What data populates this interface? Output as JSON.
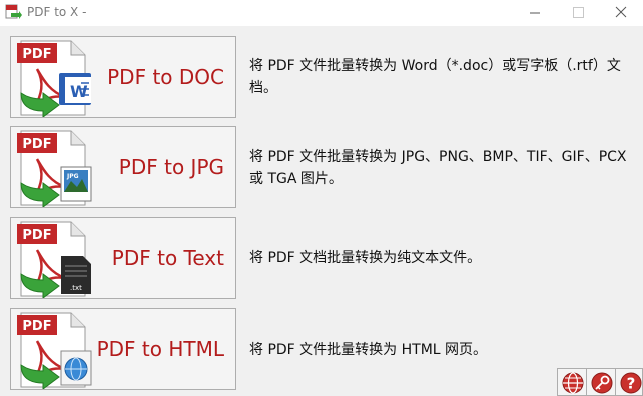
{
  "window": {
    "title": "PDF to X -",
    "minimize_symbol": "—",
    "maximize_symbol": "☐",
    "close_symbol": "✕"
  },
  "tools": [
    {
      "label": "PDF to DOC",
      "badge": "PDF",
      "sub_icon": "word-document-icon",
      "description": "将 PDF 文件批量转换为 Word（*.doc）或写字板（.rtf）文档。"
    },
    {
      "label": "PDF to JPG",
      "badge": "PDF",
      "sub_icon": "jpg-image-icon",
      "sub_text": "JPG",
      "description": "将 PDF 文件批量转换为 JPG、PNG、BMP、TIF、GIF、PCX 或 TGA 图片。"
    },
    {
      "label": "PDF to Text",
      "badge": "PDF",
      "sub_icon": "txt-file-icon",
      "sub_text": ".txt",
      "description": "将 PDF 文档批量转换为纯文本文件。"
    },
    {
      "label": "PDF to HTML",
      "badge": "PDF",
      "sub_icon": "html-globe-icon",
      "description": "将 PDF 文件批量转换为 HTML 网页。"
    }
  ],
  "corner_buttons": [
    {
      "icon": "globe-icon"
    },
    {
      "icon": "key-icon"
    },
    {
      "icon": "help-icon"
    }
  ],
  "colors": {
    "label_red": "#b31c1c",
    "badge_red": "#c2282a",
    "arrow_green": "#3aa33a",
    "panel_bg": "#f0f0f0",
    "button_border": "#adadad"
  }
}
